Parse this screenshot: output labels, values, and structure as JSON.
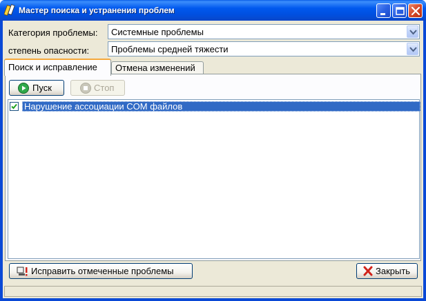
{
  "window": {
    "title": "Мастер поиска и устранения проблем",
    "controls": [
      "minimize-icon",
      "maximize-icon",
      "close-icon"
    ]
  },
  "filters": {
    "category_label": "Категория проблемы:",
    "category_value": "Системные проблемы",
    "severity_label": "степень опасности:",
    "severity_value": "Проблемы средней тяжести"
  },
  "tabs": [
    {
      "label": "Поиск и исправление",
      "active": true
    },
    {
      "label": "Отмена изменений",
      "active": false
    }
  ],
  "toolbar": {
    "start_label": "Пуск",
    "stop_label": "Стоп"
  },
  "problems": [
    {
      "label": "Нарушение ассоциации COM файлов",
      "checked": true,
      "selected": true
    }
  ],
  "footer": {
    "fix_label": "Исправить отмеченные проблемы",
    "close_label": "Закрыть"
  },
  "colors": {
    "titlebar": "#0058ee",
    "selection": "#316ac5",
    "face": "#ece9d8",
    "start_icon": "#2fa84a",
    "close_icon": "#d0221a"
  }
}
